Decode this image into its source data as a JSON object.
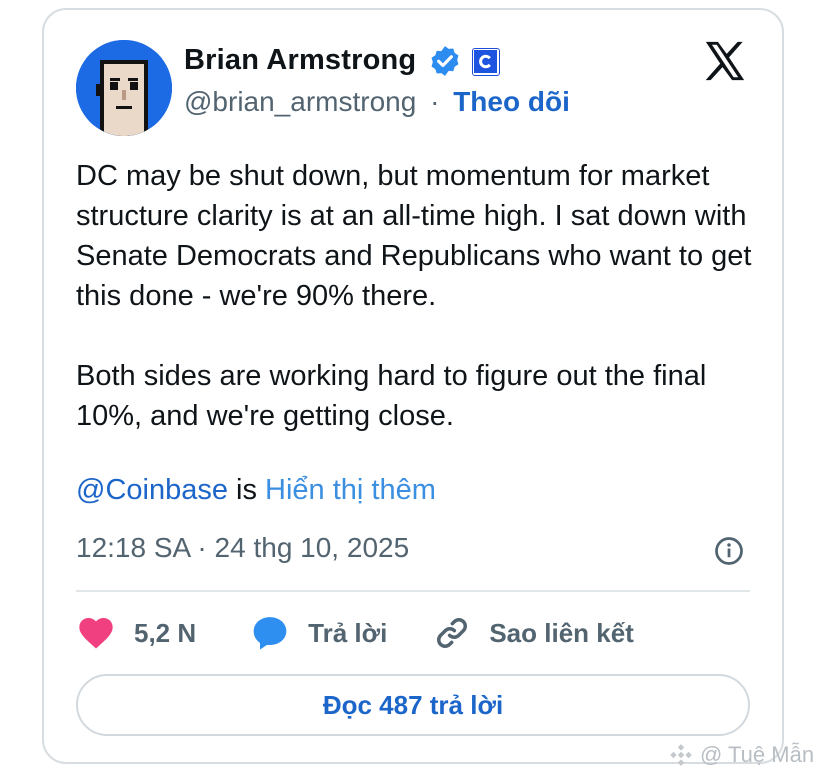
{
  "author": {
    "name": "Brian Armstrong",
    "handle": "@brian_armstrong",
    "separator": "·",
    "follow_label": "Theo dõi",
    "avatar_icon": "pixel-punk-avatar-icon",
    "verified_icon": "verified-badge-icon",
    "affiliation_icon": "coinbase-affiliate-badge-icon"
  },
  "platform_icon": "x-logo-icon",
  "tweet": {
    "paragraph1": "DC may be shut down, but momentum for market structure clarity is at an all-time high. I sat down with Senate Democrats and Republicans who want to get this done - we're 90% there.",
    "paragraph2": "Both sides are working hard to figure out the final 10%, and we're getting close.",
    "mention": "@Coinbase",
    "mention_suffix": " is ",
    "show_more": "Hiển thị thêm",
    "timestamp": "12:18 SA · 24 thg 10, 2025"
  },
  "actions": {
    "likes": "5,2 N",
    "reply_label": "Trả lời",
    "copy_link_label": "Sao liên kết"
  },
  "read_replies_label": "Đọc 487 trả lời",
  "watermark": "@ Tuệ Mẫn",
  "colors": {
    "link_blue": "#1d66c9",
    "like_pink": "#f0407f",
    "reply_blue": "#2f8ff0",
    "text": "#0f1419",
    "muted": "#536471"
  }
}
